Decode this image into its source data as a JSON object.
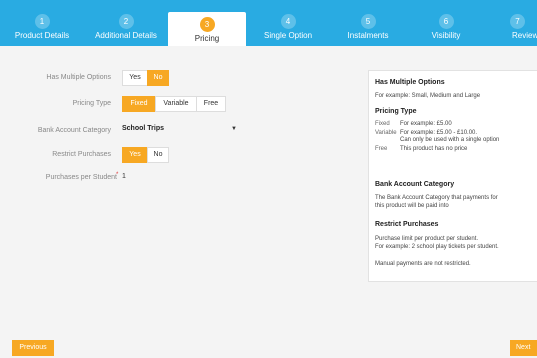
{
  "tabs": [
    {
      "num": "1",
      "label": "Product Details"
    },
    {
      "num": "2",
      "label": "Additional Details"
    },
    {
      "num": "3",
      "label": "Pricing"
    },
    {
      "num": "4",
      "label": "Single Option"
    },
    {
      "num": "5",
      "label": "Instalments"
    },
    {
      "num": "6",
      "label": "Visibility"
    },
    {
      "num": "7",
      "label": "Review"
    }
  ],
  "form": {
    "multiple_options": {
      "label": "Has Multiple Options",
      "yes": "Yes",
      "no": "No",
      "selected": "No"
    },
    "pricing_type": {
      "label": "Pricing Type",
      "fixed": "Fixed",
      "variable": "Variable",
      "free": "Free",
      "selected": "Fixed"
    },
    "bank_account": {
      "label": "Bank Account Category",
      "value": "School Trips"
    },
    "restrict": {
      "label": "Restrict Purchases",
      "yes": "Yes",
      "no": "No",
      "selected": "Yes"
    },
    "purchases_per_student": {
      "label": "Purchases per Student",
      "required_mark": "*",
      "value": "1"
    }
  },
  "help": {
    "h1": "Has Multiple Options",
    "p1": "For example: Small, Medium and Large",
    "h2": "Pricing Type",
    "rows": [
      {
        "k": "Fixed",
        "v": "For example: £5.00"
      },
      {
        "k": "Variable",
        "v": "For example: £5.00 - £10.00.",
        "v2": "Can only be used with a single option"
      },
      {
        "k": "Free",
        "v": "This product has no price"
      }
    ],
    "h3": "Bank Account Category",
    "p3a": "The Bank Account Category that payments for",
    "p3b": "this product will be paid into",
    "h4": "Restrict Purchases",
    "p4a": "Purchase limit per product per student.",
    "p4b": "For example: 2 school play tickets per student.",
    "p5": "Manual payments are not restricted."
  },
  "footer": {
    "previous": "Previous",
    "next": "Next"
  },
  "colors": {
    "accent": "#f7a823",
    "tabbar": "#29abe2"
  }
}
